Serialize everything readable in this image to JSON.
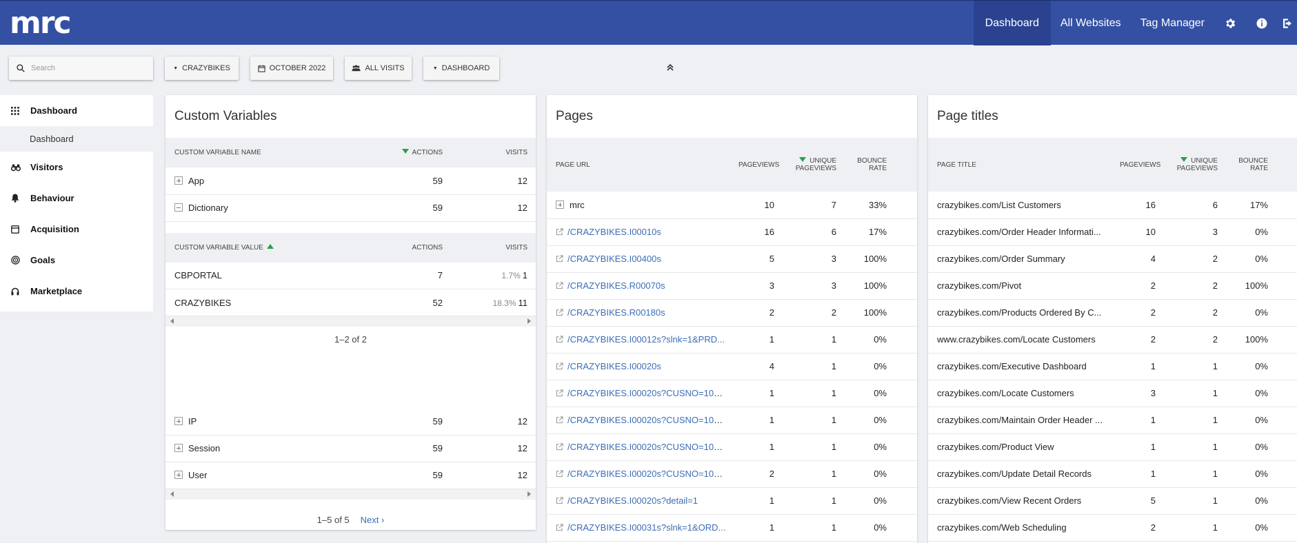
{
  "app": {
    "logo": "mrc",
    "nav": [
      {
        "label": "Dashboard"
      },
      {
        "label": "All Websites"
      },
      {
        "label": "Tag Manager"
      }
    ]
  },
  "toolbar": {
    "search_placeholder": "Search",
    "site": "CRAZYBIKES",
    "period": "OCTOBER 2022",
    "segment": "ALL VISITS",
    "dashboard": "DASHBOARD"
  },
  "sidebar": {
    "items": [
      {
        "label": "Dashboard",
        "icon": "grid-icon"
      },
      {
        "label": "Dashboard"
      },
      {
        "label": "Visitors",
        "icon": "binoculars-icon"
      },
      {
        "label": "Behaviour",
        "icon": "bell-icon"
      },
      {
        "label": "Acquisition",
        "icon": "calendar-icon"
      },
      {
        "label": "Goals",
        "icon": "target-icon"
      },
      {
        "label": "Marketplace",
        "icon": "headset-icon"
      }
    ]
  },
  "custom_variables": {
    "title": "Custom Variables",
    "name_table": {
      "headers": [
        "CUSTOM VARIABLE NAME",
        "ACTIONS",
        "VISITS"
      ],
      "rows": [
        {
          "name": "App",
          "actions": "59",
          "visits": "12"
        },
        {
          "name": "Dictionary",
          "actions": "59",
          "visits": "12"
        }
      ]
    },
    "value_table": {
      "headers": [
        "CUSTOM VARIABLE VALUE",
        "ACTIONS",
        "VISITS"
      ],
      "rows": [
        {
          "name": "CBPORTAL",
          "actions": "7",
          "pct": "1.7%",
          "visits": "1"
        },
        {
          "name": "CRAZYBIKES",
          "actions": "52",
          "pct": "18.3%",
          "visits": "11"
        }
      ],
      "pagination": "1–2 of 2"
    },
    "more_rows": [
      {
        "name": "IP",
        "actions": "59",
        "visits": "12"
      },
      {
        "name": "Session",
        "actions": "59",
        "visits": "12"
      },
      {
        "name": "User",
        "actions": "59",
        "visits": "12"
      }
    ],
    "pagination": "1–5 of 5",
    "next": "Next ›"
  },
  "pages": {
    "title": "Pages",
    "headers": [
      "PAGE URL",
      "PAGEVIEWS",
      "UNIQUE PAGEVIEWS",
      "BOUNCE RATE"
    ],
    "rows": [
      {
        "url": "mrc",
        "pageviews": "10",
        "unique": "7",
        "bounce": "33%"
      },
      {
        "url": "/CRAZYBIKES.I00010s",
        "pageviews": "16",
        "unique": "6",
        "bounce": "17%"
      },
      {
        "url": "/CRAZYBIKES.I00400s",
        "pageviews": "5",
        "unique": "3",
        "bounce": "100%"
      },
      {
        "url": "/CRAZYBIKES.R00070s",
        "pageviews": "3",
        "unique": "3",
        "bounce": "100%"
      },
      {
        "url": "/CRAZYBIKES.R00180s",
        "pageviews": "2",
        "unique": "2",
        "bounce": "100%"
      },
      {
        "url": "/CRAZYBIKES.I00012s?slnk=1&PRD...",
        "pageviews": "1",
        "unique": "1",
        "bounce": "0%"
      },
      {
        "url": "/CRAZYBIKES.I00020s",
        "pageviews": "4",
        "unique": "1",
        "bounce": "0%"
      },
      {
        "url": "/CRAZYBIKES.I00020s?CUSNO=100...",
        "pageviews": "1",
        "unique": "1",
        "bounce": "0%"
      },
      {
        "url": "/CRAZYBIKES.I00020s?CUSNO=100...",
        "pageviews": "1",
        "unique": "1",
        "bounce": "0%"
      },
      {
        "url": "/CRAZYBIKES.I00020s?CUSNO=100...",
        "pageviews": "1",
        "unique": "1",
        "bounce": "0%"
      },
      {
        "url": "/CRAZYBIKES.I00020s?CUSNO=100...",
        "pageviews": "2",
        "unique": "1",
        "bounce": "0%"
      },
      {
        "url": "/CRAZYBIKES.I00020s?detail=1",
        "pageviews": "1",
        "unique": "1",
        "bounce": "0%"
      },
      {
        "url": "/CRAZYBIKES.I00031s?slnk=1&ORD...",
        "pageviews": "1",
        "unique": "1",
        "bounce": "0%"
      }
    ]
  },
  "page_titles": {
    "title": "Page titles",
    "headers": [
      "PAGE TITLE",
      "PAGEVIEWS",
      "UNIQUE PAGEVIEWS",
      "BOUNCE RATE"
    ],
    "rows": [
      {
        "title": "crazybikes.com/List Customers",
        "pageviews": "16",
        "unique": "6",
        "bounce": "17%"
      },
      {
        "title": "crazybikes.com/Order Header Informati...",
        "pageviews": "10",
        "unique": "3",
        "bounce": "0%"
      },
      {
        "title": "crazybikes.com/Order Summary",
        "pageviews": "4",
        "unique": "2",
        "bounce": "0%"
      },
      {
        "title": "crazybikes.com/Pivot",
        "pageviews": "2",
        "unique": "2",
        "bounce": "100%"
      },
      {
        "title": "crazybikes.com/Products Ordered By C...",
        "pageviews": "2",
        "unique": "2",
        "bounce": "0%"
      },
      {
        "title": "www.crazybikes.com/Locate Customers",
        "pageviews": "2",
        "unique": "2",
        "bounce": "100%"
      },
      {
        "title": "crazybikes.com/Executive Dashboard",
        "pageviews": "1",
        "unique": "1",
        "bounce": "0%"
      },
      {
        "title": "crazybikes.com/Locate Customers",
        "pageviews": "3",
        "unique": "1",
        "bounce": "0%"
      },
      {
        "title": "crazybikes.com/Maintain Order Header ...",
        "pageviews": "1",
        "unique": "1",
        "bounce": "0%"
      },
      {
        "title": "crazybikes.com/Product View",
        "pageviews": "1",
        "unique": "1",
        "bounce": "0%"
      },
      {
        "title": "crazybikes.com/Update Detail Records",
        "pageviews": "1",
        "unique": "1",
        "bounce": "0%"
      },
      {
        "title": "crazybikes.com/View Recent Orders",
        "pageviews": "5",
        "unique": "1",
        "bounce": "0%"
      },
      {
        "title": "crazybikes.com/Web Scheduling",
        "pageviews": "2",
        "unique": "1",
        "bounce": "0%"
      }
    ]
  }
}
